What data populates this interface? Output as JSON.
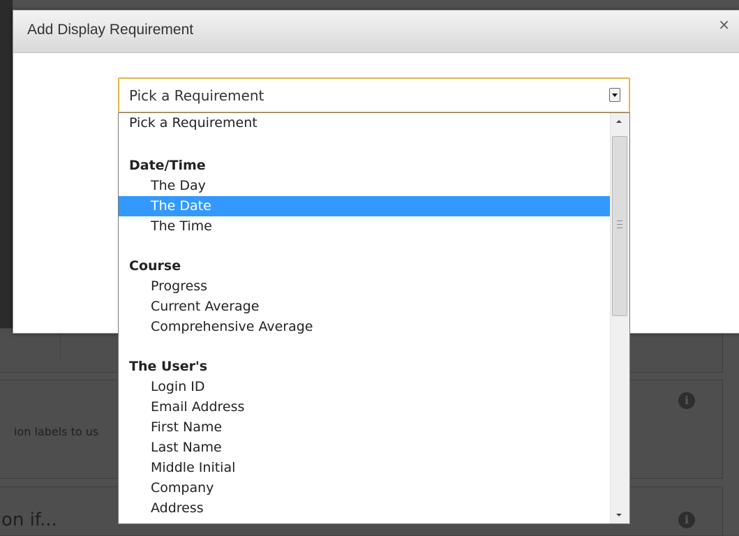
{
  "dialog": {
    "title": "Add Display Requirement",
    "close_label": "×"
  },
  "select": {
    "value": "Pick a Requirement"
  },
  "dropdown": {
    "placeholder": "Pick a Requirement",
    "selected_option": "The Date",
    "selected_color": "#3399ff",
    "groups": [
      {
        "label": "Date/Time",
        "options": [
          "The Day",
          "The Date",
          "The Time"
        ]
      },
      {
        "label": "Course",
        "options": [
          "Progress",
          "Current Average",
          "Comprehensive Average"
        ]
      },
      {
        "label": "The User's",
        "options": [
          "Login ID",
          "Email Address",
          "First Name",
          "Last Name",
          "Middle Initial",
          "Company",
          "Address"
        ]
      }
    ]
  },
  "background": {
    "labels_text": "ion labels to us",
    "condition_text": "on if..."
  },
  "colors": {
    "select_border": "#e0b64e",
    "overlay": "#505050"
  }
}
